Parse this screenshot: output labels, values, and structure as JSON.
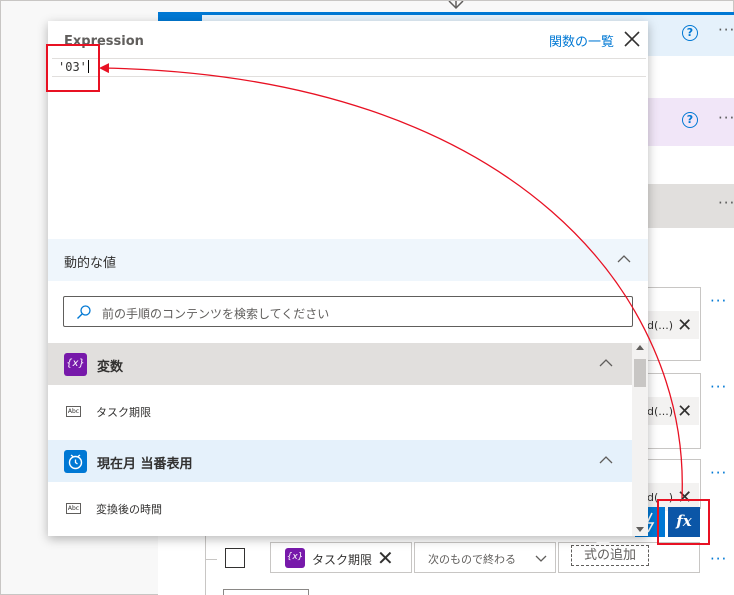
{
  "popup": {
    "title": "Expression",
    "function_list_link": "関数の一覧",
    "expression_value": "'03'"
  },
  "dynamic_content": {
    "header": "動的な値",
    "search_placeholder": "前の手順のコンテンツを検索してください",
    "groups": [
      {
        "label": "変数",
        "icon": "{x}",
        "icon_color": "#7719aa",
        "items": [
          "タスク期限"
        ]
      },
      {
        "label": "現在月 当番表用",
        "icon": "clock-icon",
        "icon_color": "#0078d4",
        "items": [
          "変換後の時間"
        ]
      }
    ]
  },
  "condition_row": {
    "variable_chip_icon": "{x}",
    "variable_chip_label": "タスク期限",
    "operator": "次のもので終わる",
    "add_expression_label": "式の追加"
  },
  "fx_button_label": "fx",
  "background": {
    "chip_text": "d(...)",
    "chip_text_2": "d(...)",
    "chip_text_3": "d(...)",
    "more_dots": "···"
  },
  "colors": {
    "accent_blue": "#0078d4",
    "variable_purple": "#7719aa",
    "annotation_red": "#e81123"
  }
}
